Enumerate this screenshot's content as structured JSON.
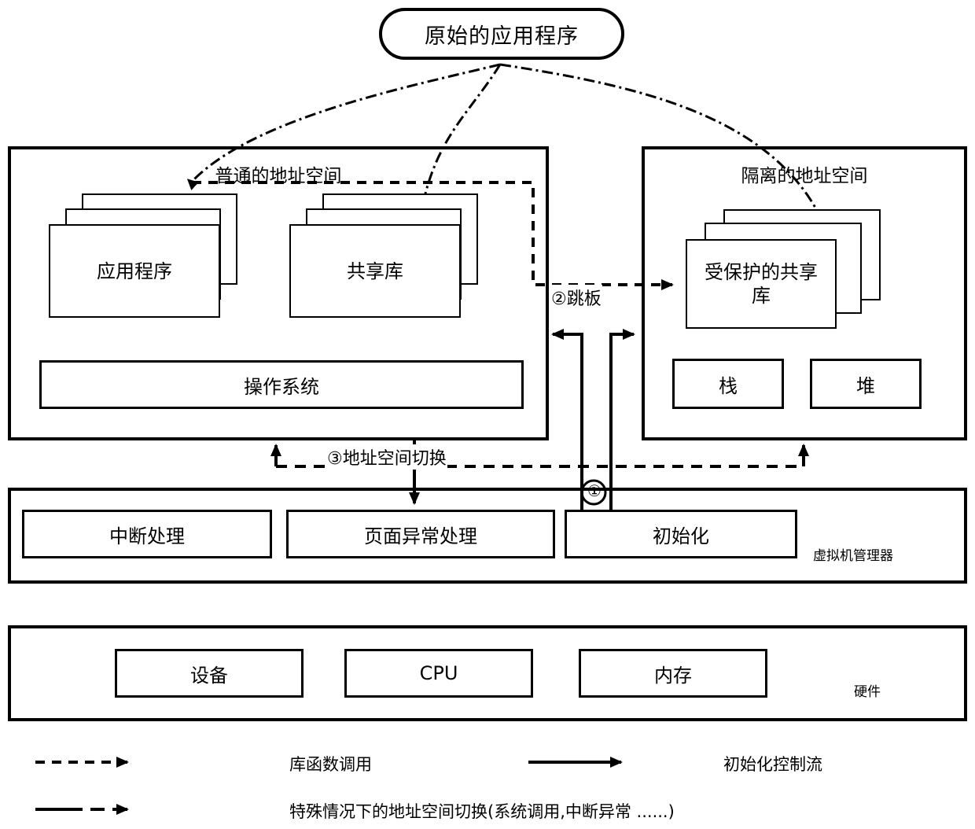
{
  "diagram": {
    "title_node": {
      "label": "原始的应用程序"
    },
    "normal_space": {
      "title": "普通的地址空间",
      "app_stack": {
        "label": "应用程序"
      },
      "shared_lib_stack": {
        "label": "共享库"
      },
      "os_box": {
        "label": "操作系统"
      }
    },
    "isolated_space": {
      "title": "隔离的地址空间",
      "protected_lib_stack": {
        "label": "受保护的共享库"
      },
      "stack_box": {
        "label": "栈"
      },
      "heap_box": {
        "label": "堆"
      }
    },
    "trampoline": {
      "label": "②跳板"
    },
    "address_switch": {
      "label": "③地址空间切换"
    },
    "init_marker": {
      "label": "①"
    },
    "hypervisor": {
      "side_label": "虚拟机管理器",
      "boxes": [
        {
          "label": "中断处理"
        },
        {
          "label": "页面异常处理"
        },
        {
          "label": "初始化"
        }
      ]
    },
    "hardware": {
      "side_label": "硬件",
      "boxes": [
        {
          "label": "设备"
        },
        {
          "label": "CPU"
        },
        {
          "label": "内存"
        }
      ]
    },
    "legend": {
      "items": [
        {
          "style": "dashed-arrow",
          "label": "库函数调用"
        },
        {
          "style": "solid-arrow",
          "label": "初始化控制流"
        },
        {
          "style": "dashdot-arrow",
          "label": "特殊情况下的地址空间切换(系统调用,中断异常 ......)"
        }
      ]
    },
    "colors": {
      "stroke": "#000000",
      "background": "#ffffff"
    }
  }
}
